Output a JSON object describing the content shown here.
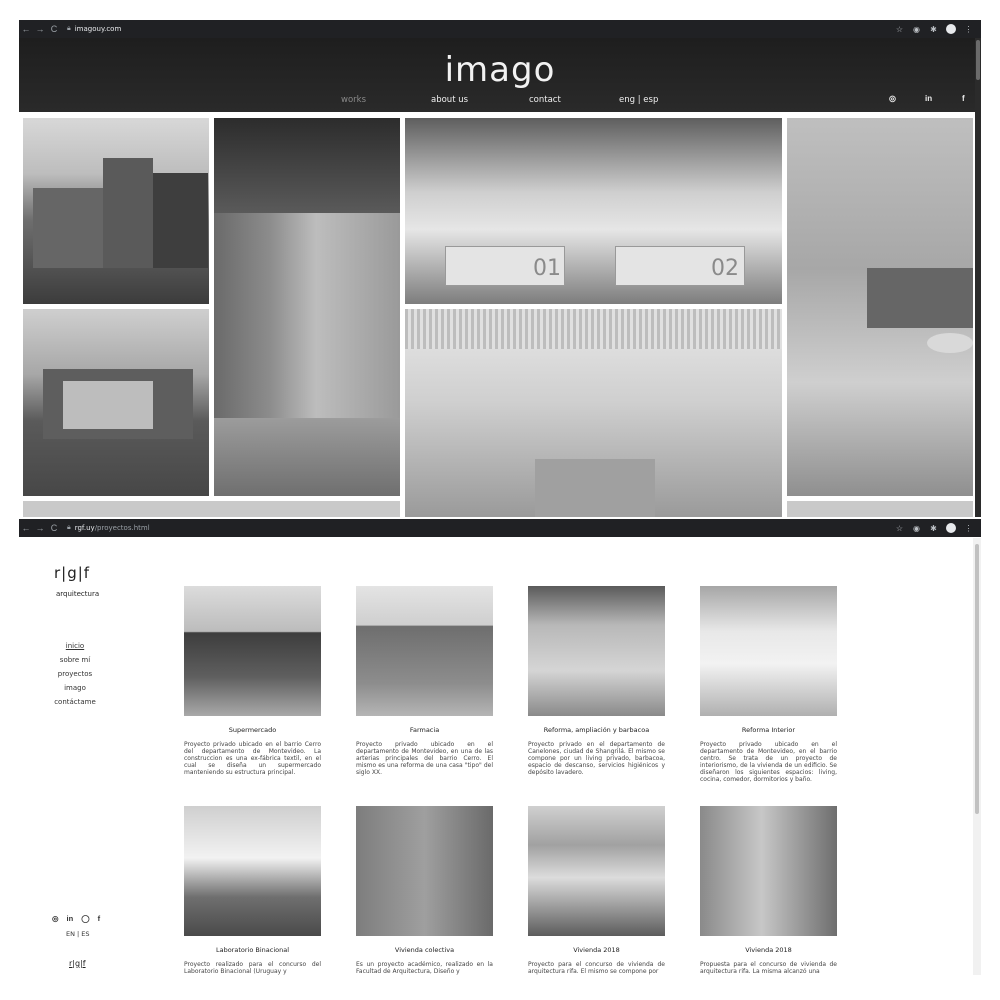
{
  "browser_top": {
    "url": "imagouy.com",
    "url_path": ""
  },
  "browser_bottom": {
    "url": "rgf.uy",
    "url_path": "/proyectos.html"
  },
  "imago": {
    "logo": "imago",
    "nav": [
      "works",
      "about us",
      "contact",
      "eng | esp"
    ],
    "social": [
      "◎",
      "in",
      "f"
    ],
    "tile_labels": [
      "01",
      "02"
    ]
  },
  "rgf": {
    "logo": "r|g|f",
    "subtitle": "arquitectura",
    "nav": [
      "inicio",
      "sobre mí",
      "proyectos",
      "imago",
      "contáctame"
    ],
    "social": [
      "◎",
      "in",
      "◯",
      "f"
    ],
    "lang": "EN | ES",
    "mini_logo": "r|g|f",
    "projects": [
      {
        "title": "Supermercado",
        "desc": "Proyecto privado ubicado en el barrio Cerro del departamento de Montevideo. La construccion es una ex-fábrica textil, en el cual se diseña un supermercado manteniendo su estructura principal."
      },
      {
        "title": "Farmacia",
        "desc": "Proyecto privado ubicado en el departamento de Montevideo, en una de las arterias principales del barrio Cerro. El mismo es una reforma de una casa \"tipo\" del siglo XX."
      },
      {
        "title": "Reforma, ampliación y barbacoa",
        "desc": "Proyecto privado en el departamento de Canelones, ciudad de Shangrilá. El mismo se compone por un living privado, barbacoa, espacio de descanso, servicios higiénicos y depósito lavadero."
      },
      {
        "title": "Reforma Interior",
        "desc": "Proyecto privado ubicado en el departamento de Montevideo, en el barrio centro. Se trata de un proyecto de interiorismo, de la vivienda de un edificio. Se diseñaron los siguientes espacios: living, cocina, comedor, dormitorios y baño."
      },
      {
        "title": "Laboratorio Binacional",
        "desc": "Proyecto realizado para el concurso del Laboratorio Binacional (Uruguay y"
      },
      {
        "title": "Vivienda colectiva",
        "desc": "Es un proyecto académico, realizado en la Facultad de Arquitectura, Diseño y"
      },
      {
        "title": "Vivienda 2018",
        "desc": "Proyecto para el concurso de vivienda de arquitectura rifa. El mismo se compone por"
      },
      {
        "title": "Vivienda 2018",
        "desc": "Propuesta para el concurso de vivienda de arquitectura rifa. La misma alcanzó una"
      }
    ]
  }
}
